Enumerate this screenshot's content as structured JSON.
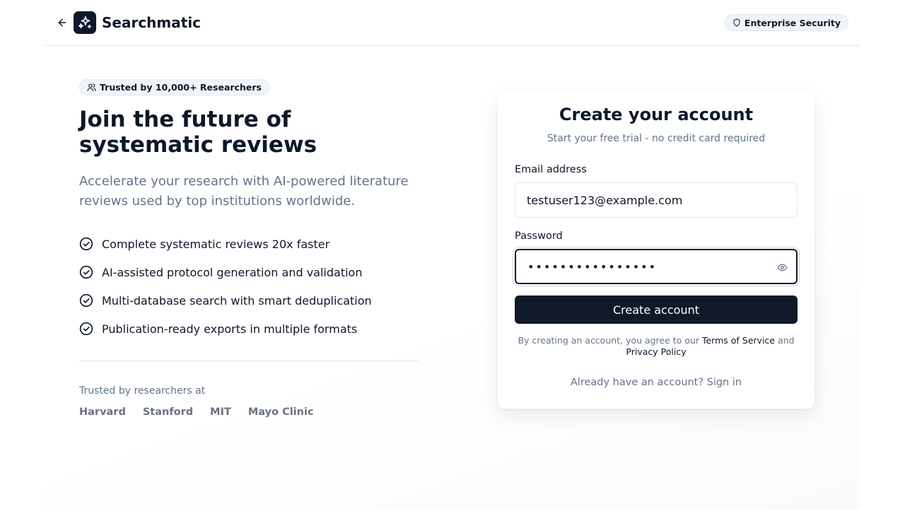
{
  "header": {
    "brand_name": "Searchmatic",
    "badge_label": "Enterprise Security"
  },
  "hero": {
    "trust_pill": "Trusted by 10,000+ Researchers",
    "headline": "Join the future of systematic reviews",
    "lede": "Accelerate your research with AI-powered literature reviews used by top institutions worldwide.",
    "features": [
      "Complete systematic reviews 20x faster",
      "AI-assisted protocol generation and validation",
      "Multi-database search with smart deduplication",
      "Publication-ready exports in multiple formats"
    ],
    "trusted_at_label": "Trusted by researchers at",
    "institutions": [
      "Harvard",
      "Stanford",
      "MIT",
      "Mayo Clinic"
    ]
  },
  "form": {
    "title": "Create your account",
    "subtitle": "Start your free trial - no credit card required",
    "email_label": "Email address",
    "email_value": "testuser123@example.com",
    "password_label": "Password",
    "password_value": "••••••••••••••••",
    "submit_label": "Create account",
    "terms_prefix": "By creating an account, you agree to our ",
    "terms_link": "Terms of Service",
    "terms_and": " and",
    "privacy_link": "Privacy Policy",
    "signin_text": "Already have an account? Sign in"
  },
  "icons": {
    "back": "arrow-left-icon",
    "logo": "sparkles-icon",
    "badge": "shield-icon",
    "pill": "users-icon",
    "feature": "check-circle-icon",
    "password_toggle": "eye-icon"
  },
  "colors": {
    "primary": "#111827",
    "muted_text": "#64748b",
    "border": "#e2e8f0"
  }
}
